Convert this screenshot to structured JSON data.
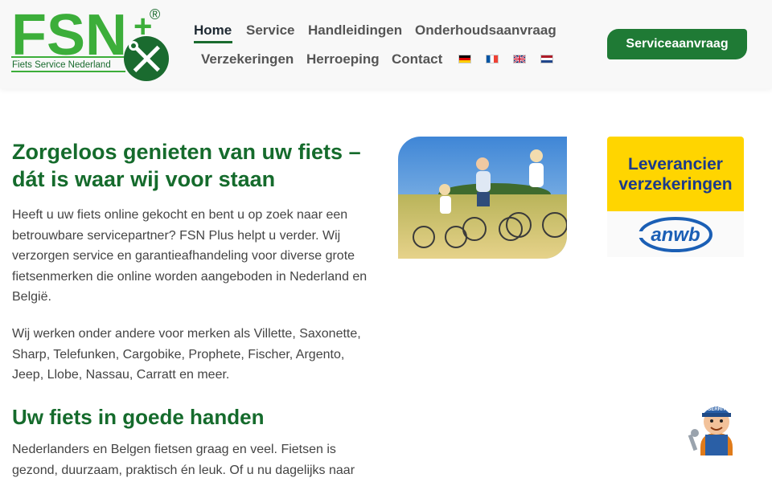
{
  "brand": {
    "logo_text": "FSN",
    "logo_plus": "+",
    "logo_reg": "®",
    "logo_subtitle": "Fiets Service Nederland"
  },
  "nav": {
    "items": [
      {
        "label": "Home",
        "active": true
      },
      {
        "label": "Service"
      },
      {
        "label": "Handleidingen"
      },
      {
        "label": "Onderhoudsaanvraag"
      },
      {
        "label": "Verzekeringen"
      },
      {
        "label": "Herroeping"
      },
      {
        "label": "Contact"
      }
    ],
    "languages": [
      "de-flag-icon",
      "fr-flag-icon",
      "gb-flag-icon",
      "nl-flag-icon"
    ]
  },
  "cta": {
    "label": "Serviceaanvraag",
    "color": "#1f7a35"
  },
  "content": {
    "heading": "Zorgeloos genieten van uw fiets – dát is waar wij voor staan",
    "para1": "Heeft u uw fiets online gekocht en bent u op zoek naar een betrouwbare servicepartner? FSN Plus helpt u verder. Wij verzorgen service en garantieafhandeling voor diverse grote fietsenmerken die online worden aangeboden in Nederland en België.",
    "para2": "Wij werken onder andere voor merken als Villette, Saxonette, Sharp, Telefunken, Cargobike, Prophete, Fischer, Argento, Jeep, Llobe, Nassau, Carratt en meer.",
    "subheading": "Uw fiets in goede handen",
    "para3": "Nederlanders en Belgen fietsen graag en veel. Fietsen is gezond, duurzaam, praktisch én leuk. Of u nu dagelijks naar"
  },
  "badge": {
    "line1": "Leverancier",
    "line2": "verzekeringen",
    "partner": "anwb"
  },
  "mascot": {
    "cap_text": "GERRIT"
  },
  "colors": {
    "brand_green": "#156b2c",
    "logo_green": "#3cae3a",
    "anwb_yellow": "#ffd500",
    "anwb_blue": "#1b5fb5"
  }
}
